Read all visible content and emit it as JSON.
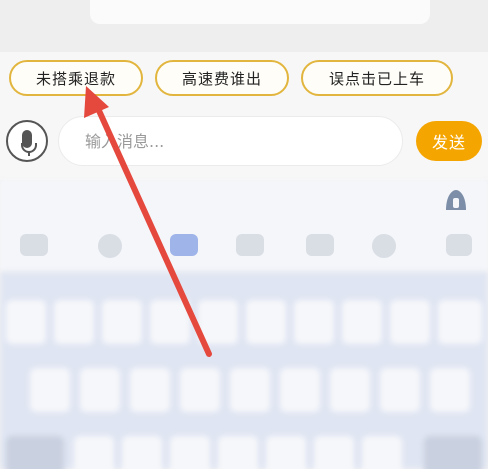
{
  "quick_replies": [
    {
      "label": "未搭乘退款"
    },
    {
      "label": "高速费谁出"
    },
    {
      "label": "误点击已上车"
    }
  ],
  "composer": {
    "placeholder": "输入消息...",
    "send_label": "发送",
    "mic_icon": "microphone-icon"
  },
  "colors": {
    "accent": "#f5a500",
    "chip_border": "#e2b63e",
    "annotation_arrow": "#e5483d"
  }
}
